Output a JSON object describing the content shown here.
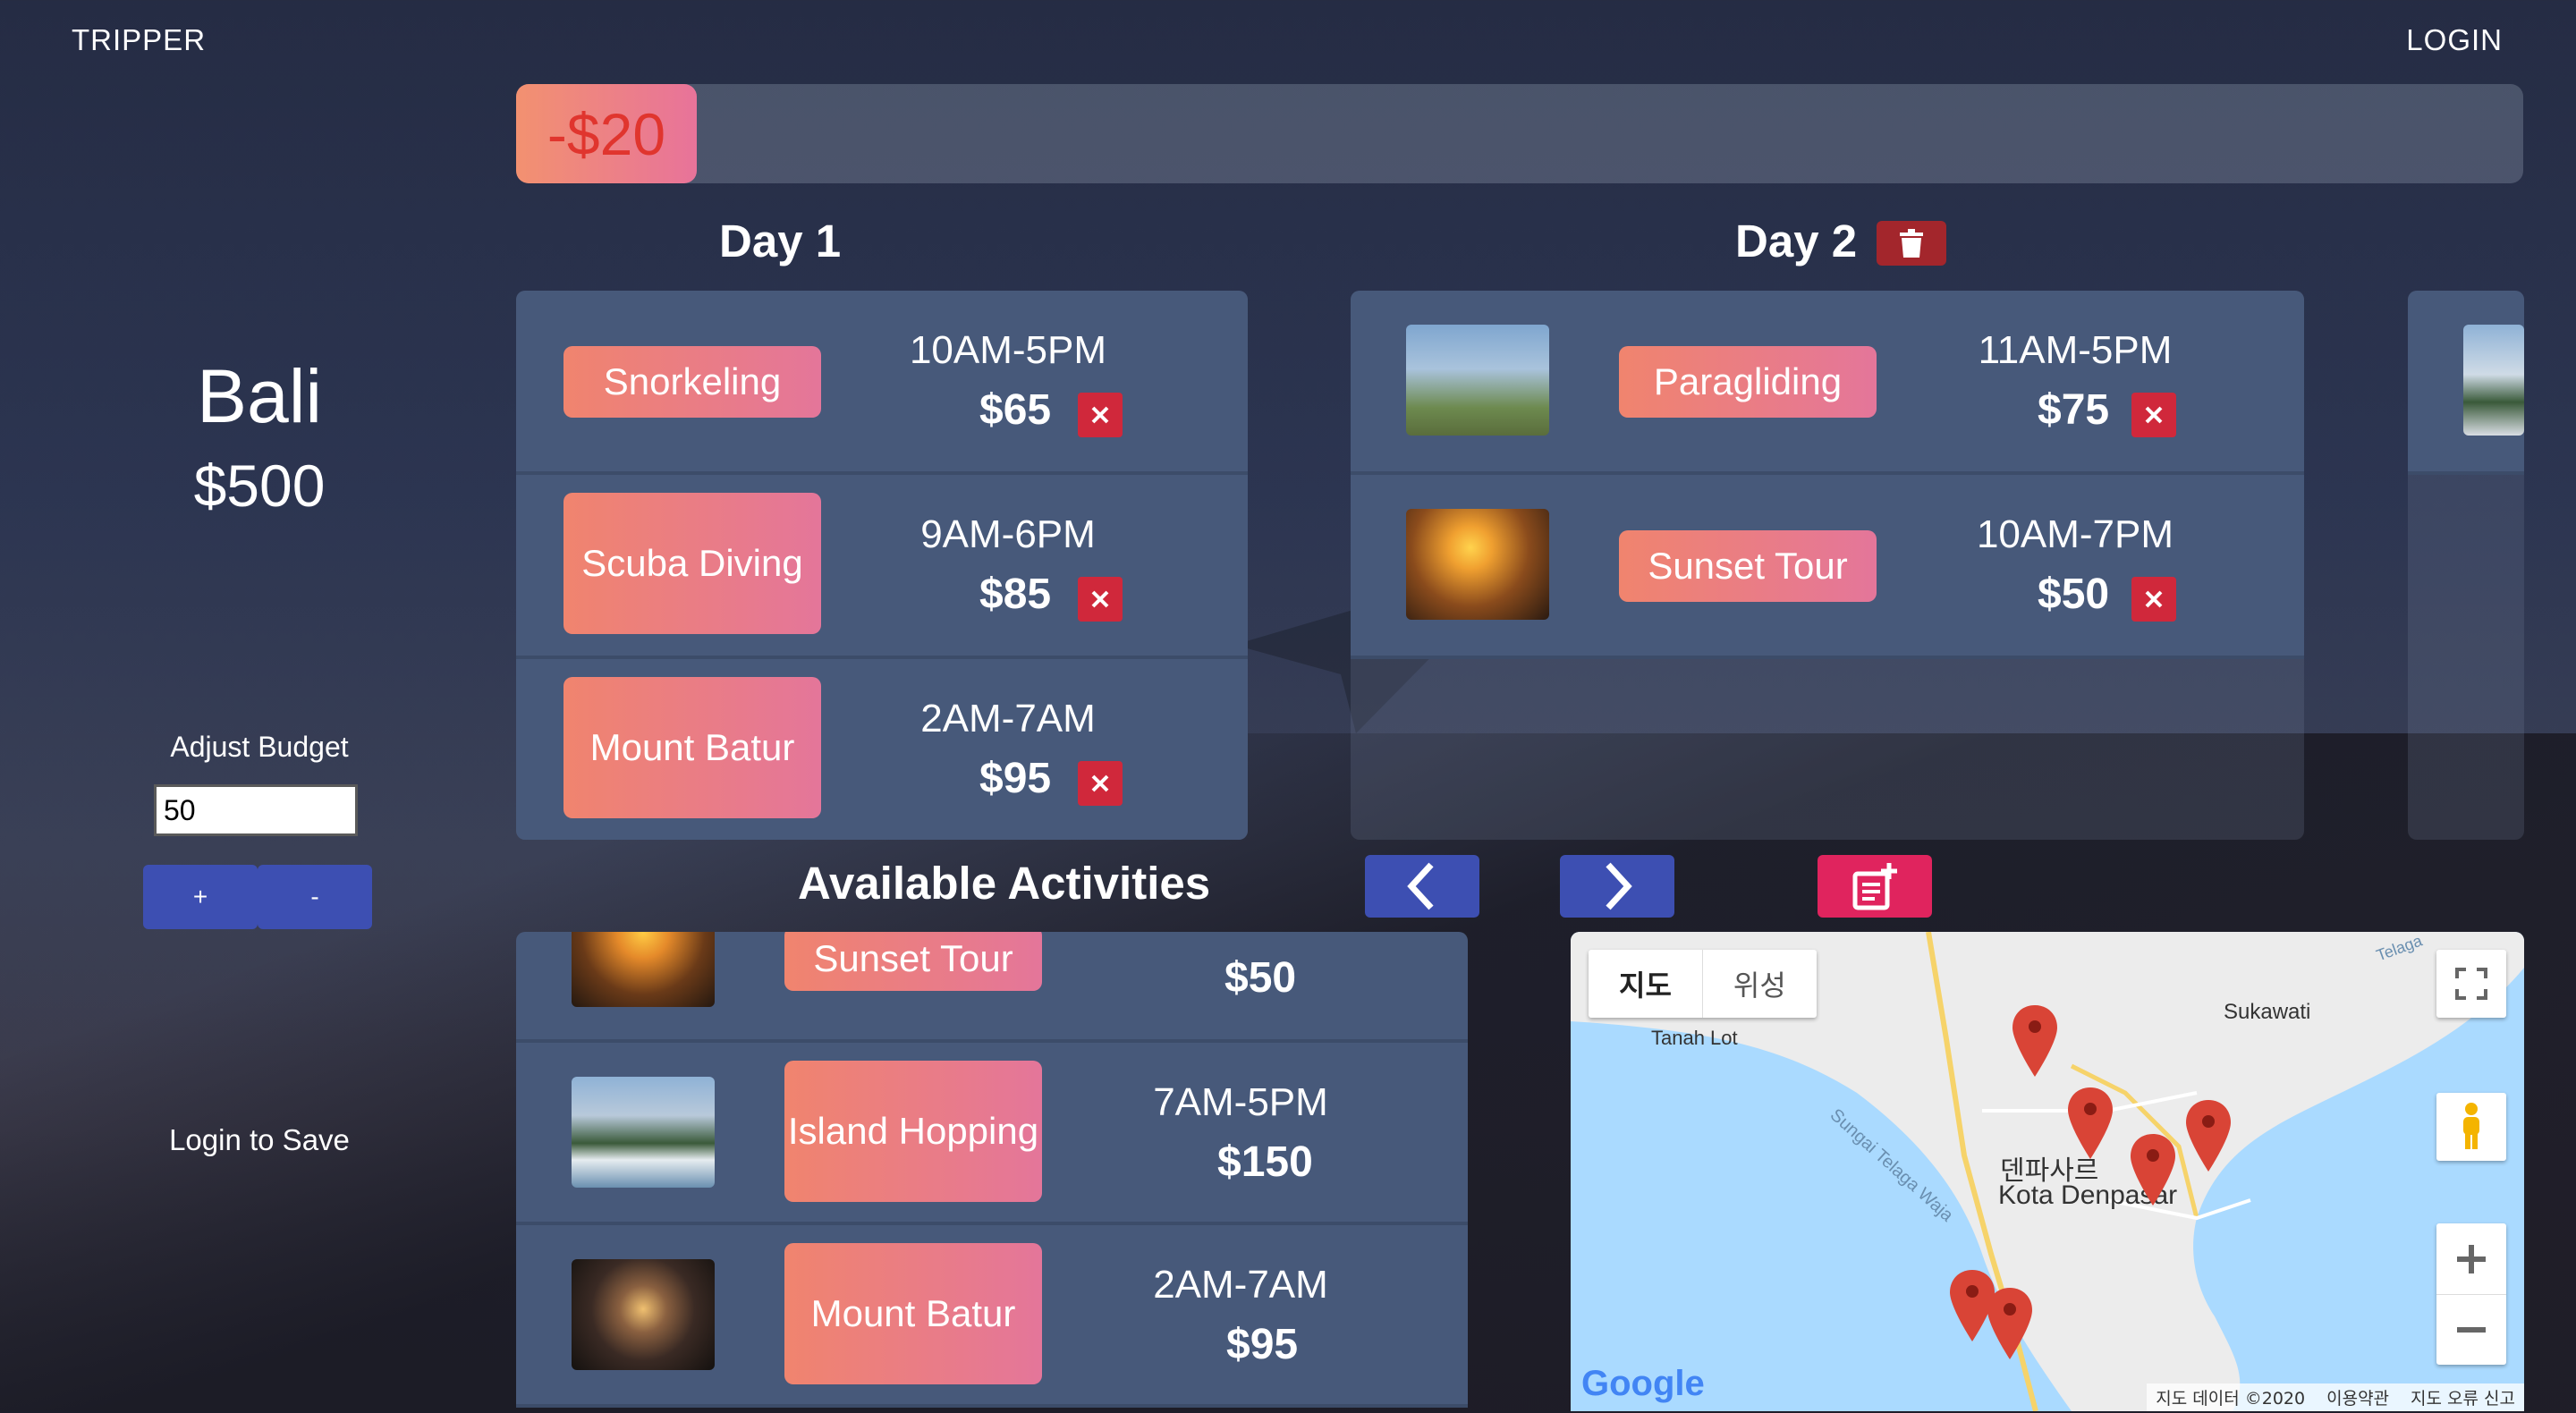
{
  "header": {
    "brand": "TRIPPER",
    "login": "LOGIN"
  },
  "budget_bar": {
    "remaining_label": "-$20",
    "fill_fraction": 0.09
  },
  "sidebar": {
    "destination": "Bali",
    "budget": "$500",
    "adjust_label": "Adjust Budget",
    "adjust_value": "50",
    "plus_label": "+",
    "minus_label": "-",
    "login_to_save": "Login to Save"
  },
  "days": [
    {
      "title": "Day 1",
      "activities": [
        {
          "name": "Snorkeling",
          "time": "10AM-5PM",
          "price": "$65"
        },
        {
          "name": "Scuba Diving",
          "time": "9AM-6PM",
          "price": "$85"
        },
        {
          "name": "Mount Batur",
          "time": "2AM-7AM",
          "price": "$95"
        }
      ]
    },
    {
      "title": "Day 2",
      "activities": [
        {
          "name": "Paragliding",
          "time": "11AM-5PM",
          "price": "$75"
        },
        {
          "name": "Sunset Tour",
          "time": "10AM-7PM",
          "price": "$50"
        }
      ]
    }
  ],
  "available": {
    "title": "Available Activities",
    "items": [
      {
        "name": "Sunset Tour",
        "time": "",
        "price": "$50"
      },
      {
        "name": "Island Hopping",
        "time": "7AM-5PM",
        "price": "$150"
      },
      {
        "name": "Mount Batur",
        "time": "2AM-7AM",
        "price": "$95"
      }
    ]
  },
  "map": {
    "type_map": "지도",
    "type_satellite": "위성",
    "labels": {
      "tanah_lot": "Tanah Lot",
      "sukawati": "Sukawati",
      "denpasar_ko": "덴파사르",
      "denpasar": "Kota Denpasar",
      "river": "Sungai Telaga Waja",
      "telaga": "Telaga"
    },
    "footer": {
      "data": "지도 데이터 ©2020",
      "terms": "이용약관",
      "report": "지도 오류 신고"
    },
    "google": "Google"
  },
  "colors": {
    "accent_blue": "#3d4fb2",
    "accent_pink": "#e0245e",
    "pill_start": "#f0846e",
    "pill_end": "#e4769a",
    "delete_red": "#d0283b",
    "card_bg": "#47597a"
  }
}
